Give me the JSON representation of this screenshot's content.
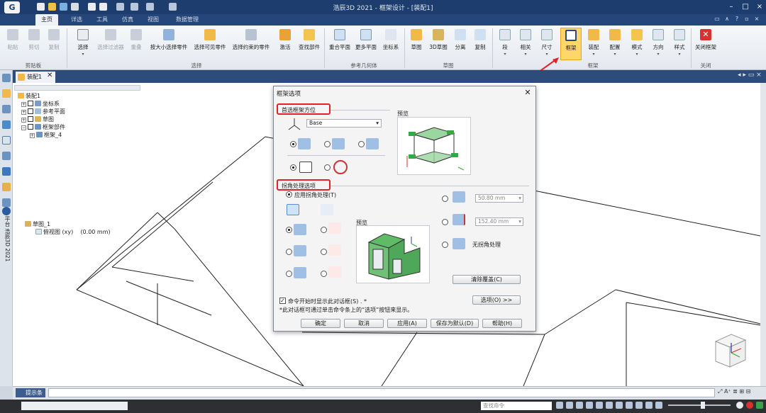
{
  "app": {
    "logo_text": "G",
    "window_title": "浩辰3D 2021 - 框架设计 - [装配1]"
  },
  "ribbon_tabs": [
    {
      "label": "主页"
    },
    {
      "label": "详选"
    },
    {
      "label": "工具"
    },
    {
      "label": "仿真"
    },
    {
      "label": "视图"
    },
    {
      "label": "数据管理"
    }
  ],
  "ribbon": {
    "clipboard": [
      "粘贴",
      "剪切",
      "复制"
    ],
    "clipboard_group": "剪贴板",
    "select": [
      "选择",
      "选择过滤器",
      "重叠",
      "按大小选择零件",
      "选择可见零件",
      "选择约束的零件",
      "激活",
      "查找部件"
    ],
    "select_group": "选择",
    "refgeo": [
      "重合平面",
      "更多平面",
      "坐标系"
    ],
    "refgeo_group": "参考几何体",
    "sketch": [
      "草图",
      "3D草图",
      "分离",
      "复制"
    ],
    "sketch_group": "草图",
    "frame": [
      "段",
      "相关",
      "尺寸",
      "框架",
      "装配",
      "配置",
      "模式",
      "方向",
      "样式"
    ],
    "frame_group": "框架",
    "close": [
      "关闭框架"
    ],
    "close_group": "关闭"
  },
  "doc_tab": "装配1",
  "tree": {
    "root": "装配1",
    "items": [
      "坐标系",
      "参考平面",
      "草图",
      "框架部件"
    ],
    "child": "框架_4",
    "sketch_node": "草图_1",
    "sketch_view": "俯视图 (xy)",
    "sketch_value": "(0.00 mm)"
  },
  "left_vertical_label": "平台 浩辰3D 2021",
  "dialog": {
    "title": "框架选项",
    "section1": "首选框架方位",
    "base_value": "Base",
    "preview_label": "预览",
    "section2": "拐角处理选项",
    "apply_corner": "应用拐角处理(T)",
    "preview2_label": "预览",
    "value1": "50.80 mm",
    "value2": "152.40 mm",
    "no_corner": "无拐角处理",
    "clear_btn": "清除覆盖(C)",
    "show_dialog": "命令开始时显示此对话框(S) . *",
    "note": "*此对话框可通过单击命令条上的“选项”按钮来显示。",
    "options_btn": "选项(O) >>",
    "ok": "确定",
    "cancel": "取消",
    "apply": "应用(A)",
    "save_default": "保存为默认(D)",
    "help": "帮助(H)"
  },
  "hint_label": "提示条",
  "find_command_placeholder": "查找命令",
  "colors": {
    "title": "#1d3d6e",
    "accent_red": "#e2222a",
    "highlight": "#ffd667",
    "preview_green": "#35a845"
  }
}
